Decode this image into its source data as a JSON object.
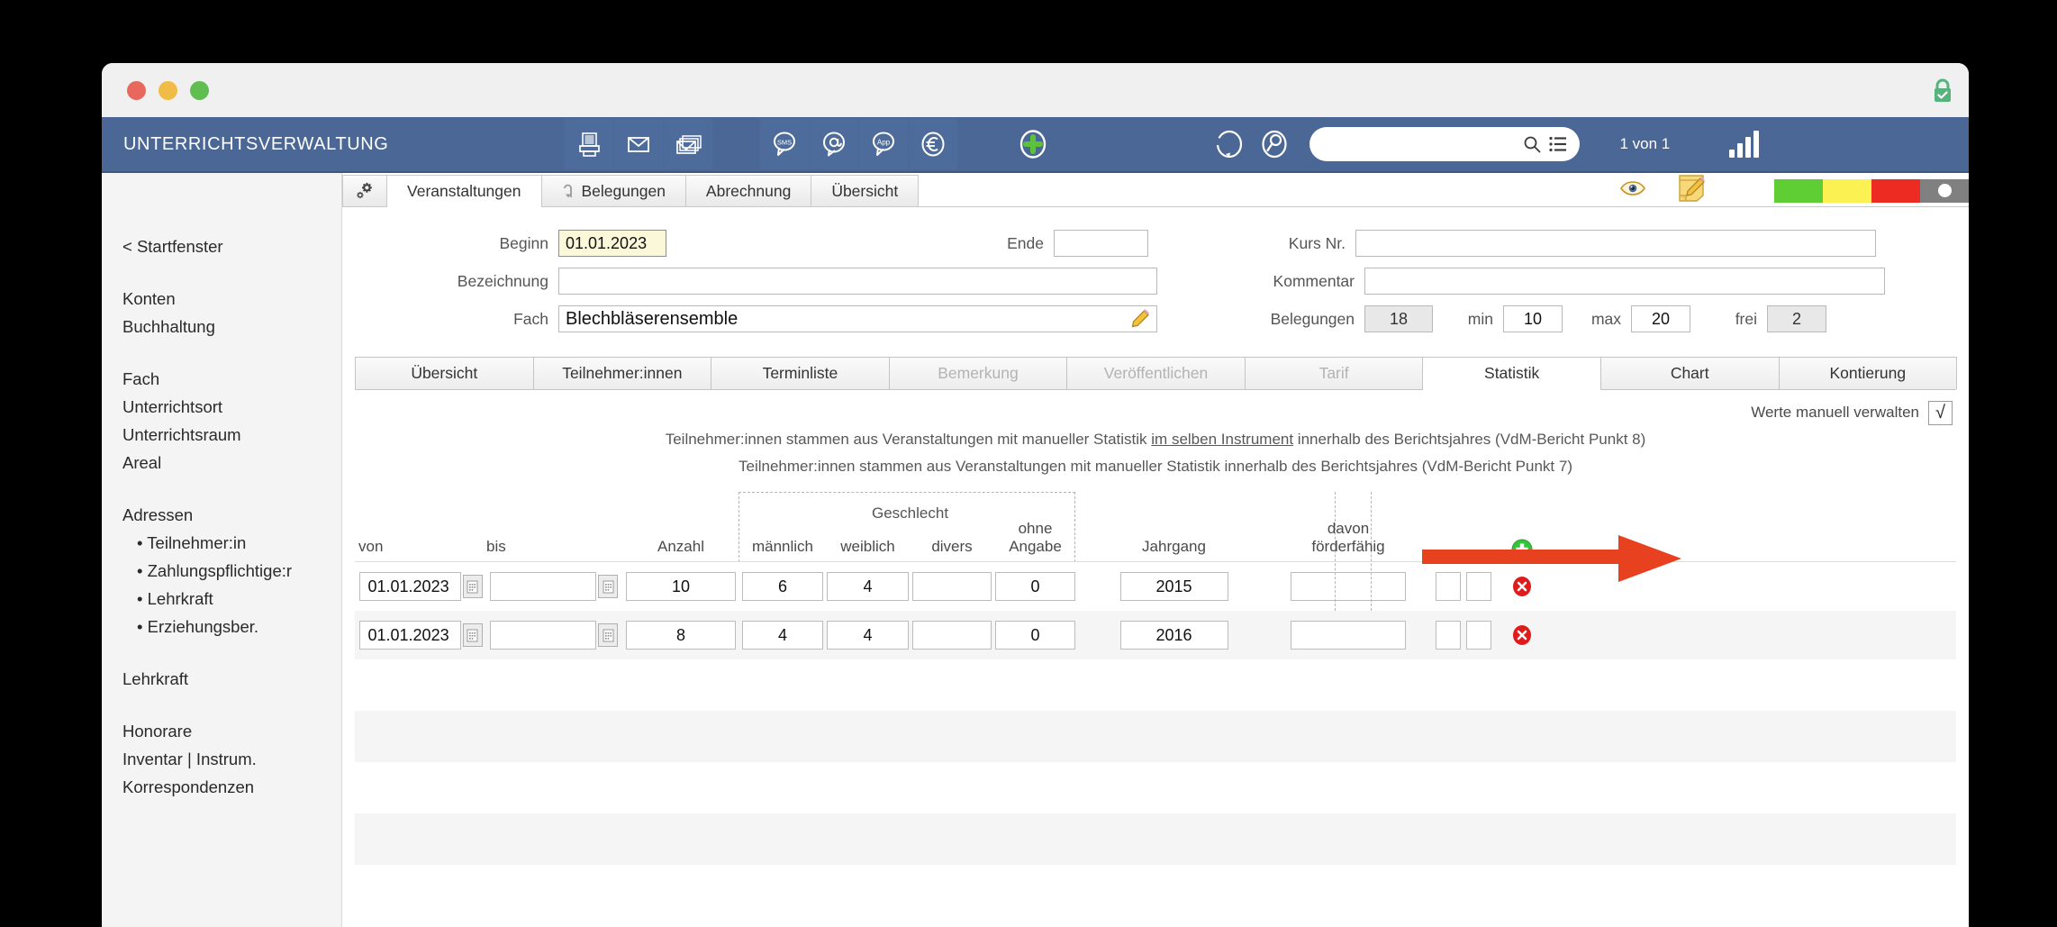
{
  "window": {
    "traffic_lights": [
      "close",
      "minimize",
      "maximize"
    ],
    "lock_icon": "lock-secure-icon"
  },
  "toolbar": {
    "app_title": "UNTERRICHTSVERWALTUNG",
    "icons_left": [
      "printer-icon",
      "envelope-icon",
      "envelopes-stack-icon"
    ],
    "icons_mid": [
      "sms-bubble-icon",
      "at-bubble-icon",
      "app-bubble-icon",
      "euro-circle-icon"
    ],
    "add_icon": "plus-circle-icon",
    "refresh_icon": "refresh-circle-icon",
    "find_icon": "magnifier-circle-icon",
    "search": {
      "value": "",
      "placeholder": ""
    },
    "search_icon": "search-icon",
    "list_icon": "list-icon",
    "pager": "1 von 1",
    "signal_icon": "signal-bars-icon"
  },
  "sidebar": {
    "back_label": "< Startfenster",
    "groups": [
      {
        "items": [
          {
            "label": "Konten"
          },
          {
            "label": "Buchhaltung"
          }
        ]
      },
      {
        "items": [
          {
            "label": "Fach"
          },
          {
            "label": "Unterrichtsort"
          },
          {
            "label": "Unterrichtsraum"
          },
          {
            "label": "Areal"
          }
        ]
      },
      {
        "items": [
          {
            "label": "Adressen"
          }
        ],
        "subitems": [
          {
            "label": "Teilnehmer:in"
          },
          {
            "label": "Zahlungspflichtige:r"
          },
          {
            "label": "Lehrkraft"
          },
          {
            "label": "Erziehungsber."
          }
        ]
      },
      {
        "items": [
          {
            "label": "Lehrkraft"
          }
        ]
      },
      {
        "items": [
          {
            "label": "Honorare"
          },
          {
            "label": "Inventar | Instrum."
          },
          {
            "label": "Korrespondenzen"
          }
        ]
      }
    ]
  },
  "top_tabs": {
    "gear_icon": "gear-icon",
    "items": [
      {
        "label": "Veranstaltungen",
        "active": true,
        "icon": null
      },
      {
        "label": "Belegungen",
        "active": false,
        "icon": "arrow-hook-icon"
      },
      {
        "label": "Abrechnung",
        "active": false,
        "icon": null
      },
      {
        "label": "Übersicht",
        "active": false,
        "icon": null
      }
    ],
    "eye_icon": "eye-icon",
    "note_icon": "note-pencil-icon",
    "status_colors": [
      "#5ece34",
      "#fbf153",
      "#ee2b22",
      "#808080"
    ],
    "status_dot": "white-dot-icon"
  },
  "form": {
    "beginn_label": "Beginn",
    "beginn_value": "01.01.2023",
    "ende_label": "Ende",
    "ende_value": "",
    "bezeichnung_label": "Bezeichnung",
    "bezeichnung_value": "",
    "fach_label": "Fach",
    "fach_value": "Blechbläserensemble",
    "fach_edit_icon": "pencil-icon",
    "kursnr_label": "Kurs Nr.",
    "kursnr_value": "",
    "kommentar_label": "Kommentar",
    "kommentar_value": "",
    "belegungen_label": "Belegungen",
    "belegungen_value": "18",
    "min_label": "min",
    "min_value": "10",
    "max_label": "max",
    "max_value": "20",
    "frei_label": "frei",
    "frei_value": "2"
  },
  "sub_tabs": [
    {
      "label": "Übersicht",
      "state": "normal"
    },
    {
      "label": "Teilnehmer:innen",
      "state": "normal"
    },
    {
      "label": "Terminliste",
      "state": "normal"
    },
    {
      "label": "Bemerkung",
      "state": "disabled"
    },
    {
      "label": "Veröffentlichen",
      "state": "disabled"
    },
    {
      "label": "Tarif",
      "state": "disabled"
    },
    {
      "label": "Statistik",
      "state": "active"
    },
    {
      "label": "Chart",
      "state": "normal"
    },
    {
      "label": "Kontierung",
      "state": "normal"
    }
  ],
  "statistik": {
    "manual_label": "Werte manuell verwalten",
    "manual_checked": "√",
    "note_1_pre": "Teilnehmer:innen stammen aus Veranstaltungen mit manueller Statistik ",
    "note_1_underline": "im selben Instrument",
    "note_1_post": " innerhalb des Berichtsjahres (VdM-Bericht Punkt 8)",
    "note_2": "Teilnehmer:innen stammen aus Veranstaltungen mit manueller Statistik innerhalb des Berichtsjahres (VdM-Bericht Punkt 7)",
    "group_header": "Geschlecht",
    "add_row_icon": "green-plus-icon",
    "delete_row_icon": "red-delete-icon",
    "calendar_icon": "calendar-picker-icon",
    "columns": [
      "von",
      "bis",
      "Anzahl",
      "männlich",
      "weiblich",
      "divers",
      "ohne\nAngabe",
      "Jahrgang",
      "davon\nförderfähig"
    ],
    "rows": [
      {
        "von": "01.01.2023",
        "bis": "",
        "anzahl": "10",
        "maennlich": "6",
        "weiblich": "4",
        "divers": "",
        "ohne_angabe": "0",
        "jahrgang": "2015",
        "foerderfaehig": "",
        "extra1": "",
        "extra2": ""
      },
      {
        "von": "01.01.2023",
        "bis": "",
        "anzahl": "8",
        "maennlich": "4",
        "weiblich": "4",
        "divers": "",
        "ohne_angabe": "0",
        "jahrgang": "2016",
        "foerderfaehig": "",
        "extra1": "",
        "extra2": ""
      }
    ],
    "empty_rows": 4
  },
  "annotation": {
    "arrow_color": "#e8411f",
    "arrow_name": "red-pointer-arrow"
  }
}
